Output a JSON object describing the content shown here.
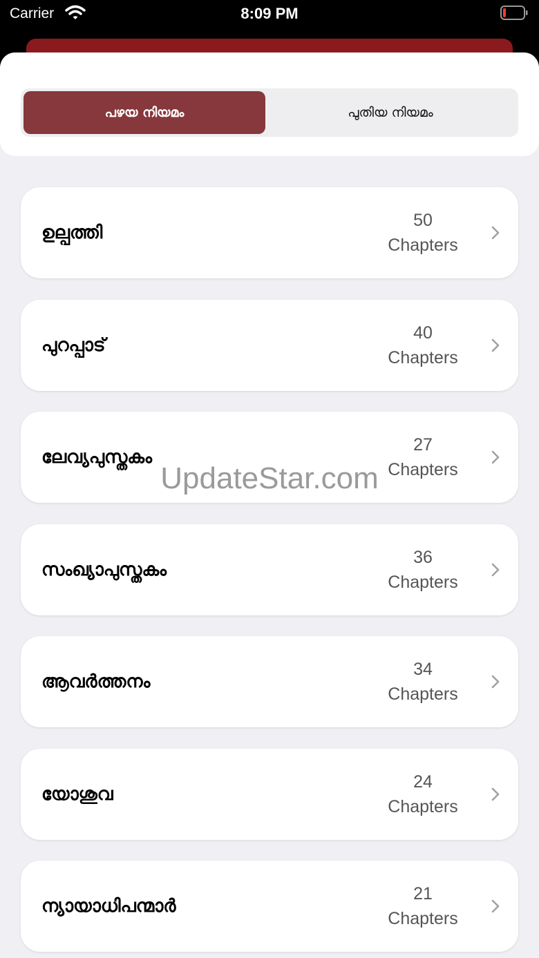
{
  "status_bar": {
    "carrier": "Carrier",
    "time": "8:09 PM",
    "battery_color": "#ff3b30"
  },
  "segments": {
    "old_testament": "പഴയ നിയമം",
    "new_testament": "പുതിയ നിയമം",
    "selected": "old_testament",
    "accent": "#86383c"
  },
  "books": [
    {
      "name": "ഉല്പത്തി",
      "count": "50",
      "unit": "Chapters"
    },
    {
      "name": "പുറപ്പാട്",
      "count": "40",
      "unit": "Chapters"
    },
    {
      "name": "ലേവ്യപുസ്തകം",
      "count": "27",
      "unit": "Chapters"
    },
    {
      "name": "സംഖ്യാപുസ്തകം",
      "count": "36",
      "unit": "Chapters"
    },
    {
      "name": "ആവർത്തനം",
      "count": "34",
      "unit": "Chapters"
    },
    {
      "name": "യോശുവ",
      "count": "24",
      "unit": "Chapters"
    },
    {
      "name": "ന്യായാധിപന്മാർ",
      "count": "21",
      "unit": "Chapters"
    }
  ],
  "watermark": "UpdateStar.com"
}
